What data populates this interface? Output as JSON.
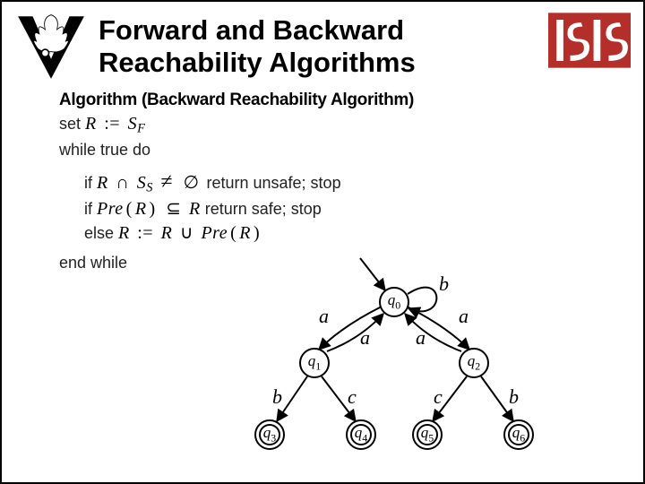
{
  "header": {
    "title": "Forward and Backward Reachability Algorithms"
  },
  "algorithm": {
    "title": "Algorithm (Backward Reachability Algorithm)",
    "init_prefix": "set ",
    "init_math": "R := S_F",
    "while": "while true do",
    "cond1_prefix": "if ",
    "cond1_math": "R ∩ S_S ≠ ∅",
    "cond1_suffix": " return unsafe; stop",
    "cond2_prefix": "if ",
    "cond2_math": "Pre(R) ⊆ R",
    "cond2_suffix": " return safe; stop",
    "else_prefix": "else ",
    "else_math": "R := R ∪ Pre(R)",
    "end": "end while"
  },
  "automaton": {
    "states": {
      "q0": "q0",
      "q1": "q1",
      "q2": "q2",
      "q3": "q3",
      "q4": "q4",
      "q5": "q5",
      "q6": "q6"
    },
    "labels": {
      "b_loop": "b",
      "a_left": "a",
      "a_right": "a",
      "a_mid_l": "a",
      "a_mid_r": "a",
      "b_q1q3": "b",
      "c_q1q4": "c",
      "c_q2q5": "c",
      "b_q2q6": "b"
    }
  }
}
